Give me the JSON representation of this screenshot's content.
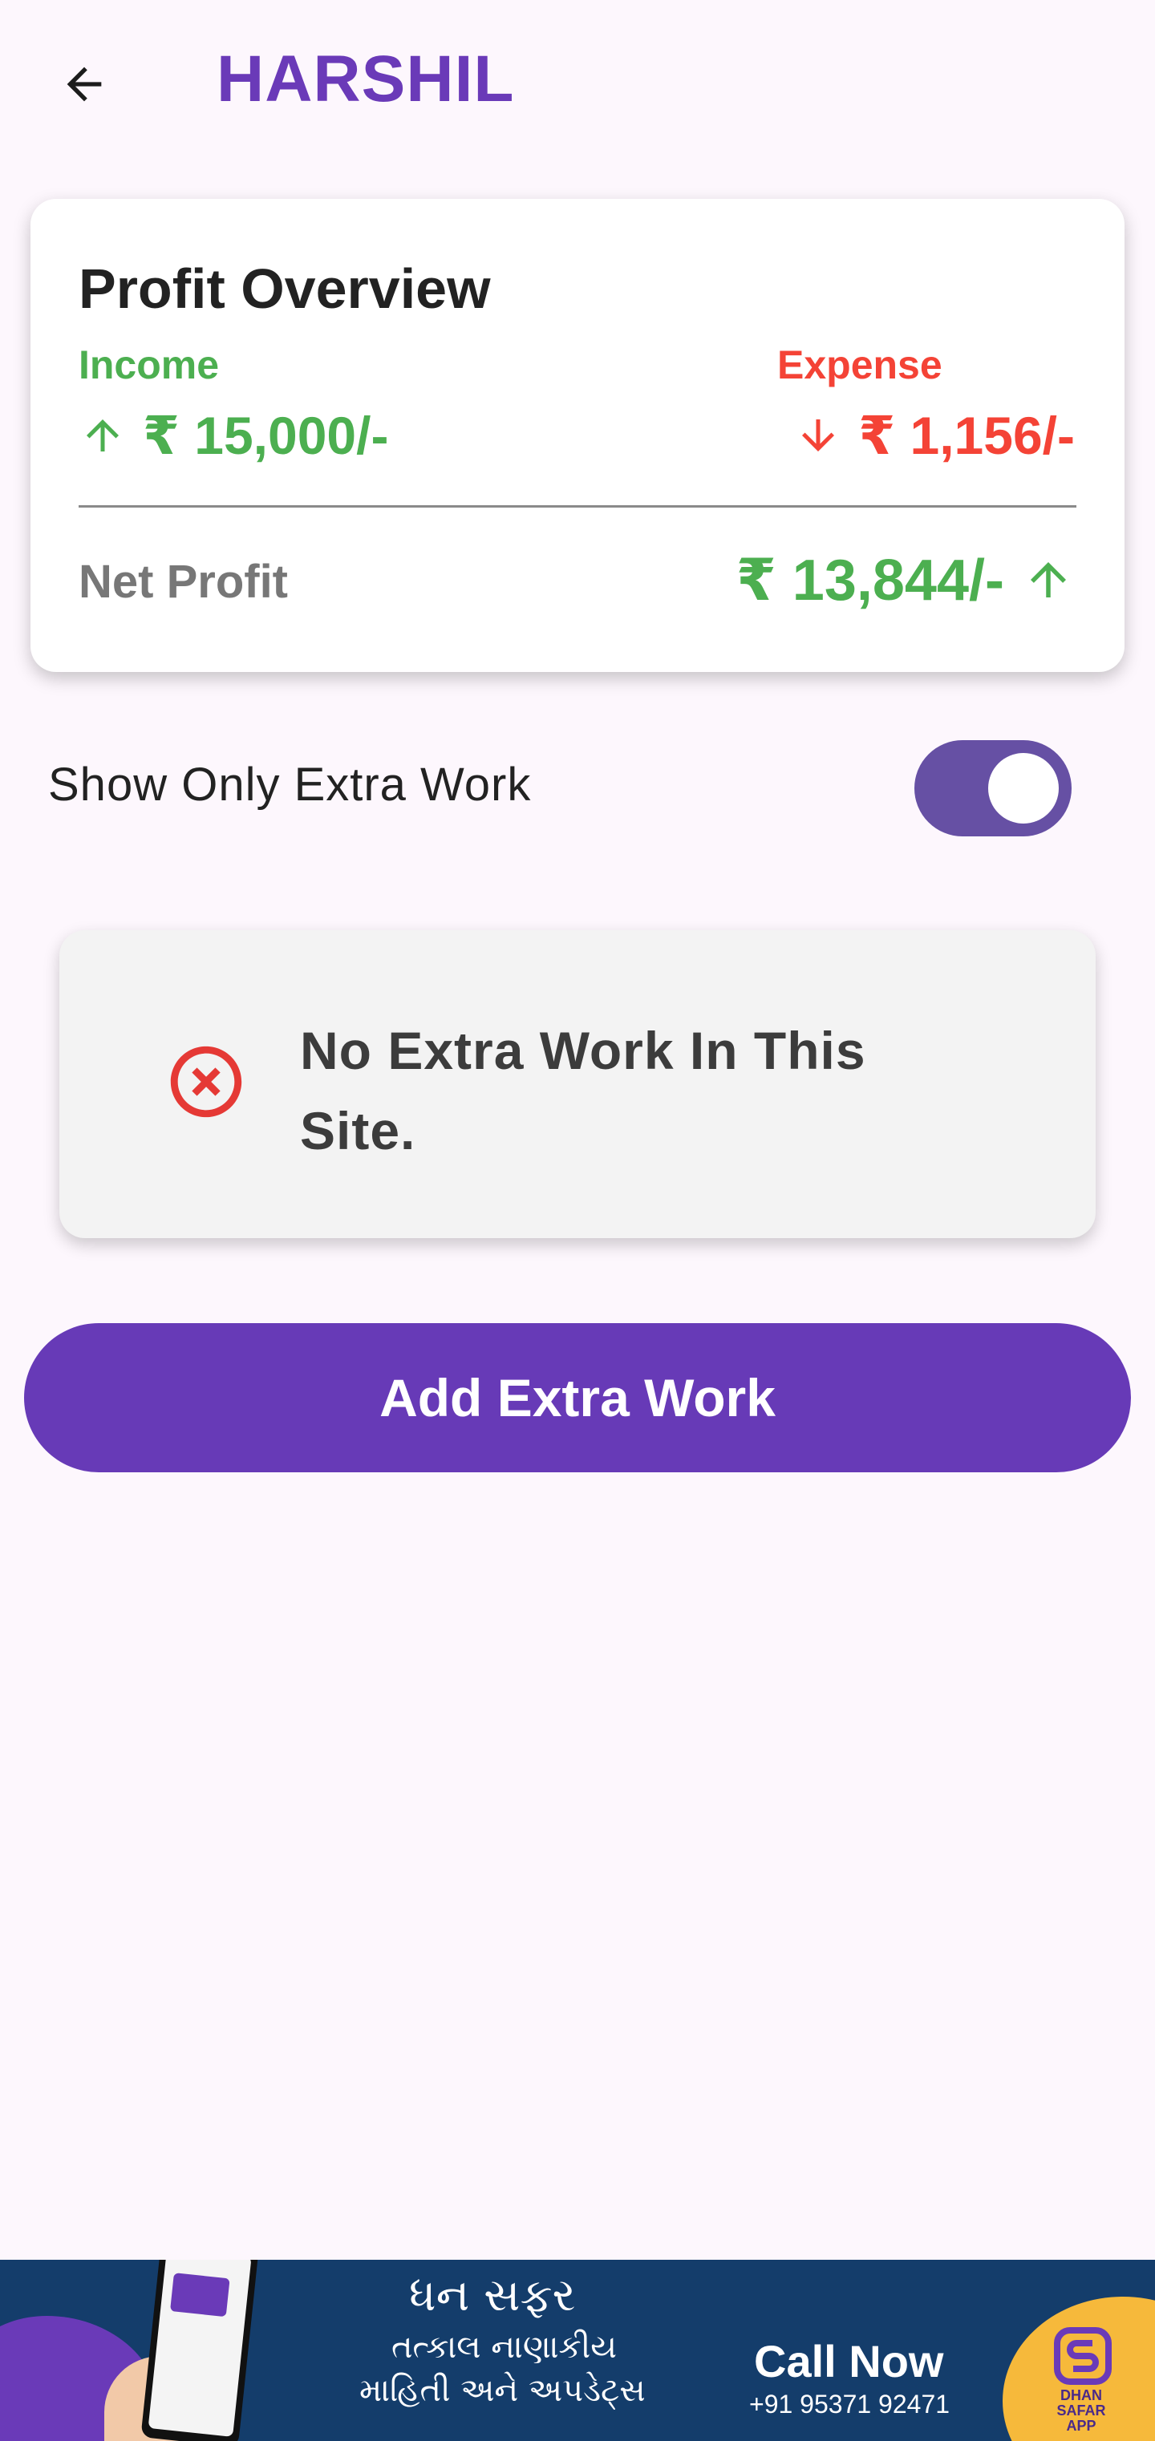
{
  "appbar": {
    "title": "HARSHIL",
    "back_icon": "arrow-back-icon"
  },
  "profit_overview": {
    "title": "Profit Overview",
    "income_label": "Income",
    "income_value": "₹ 15,000/-",
    "expense_label": "Expense",
    "expense_value": "₹ 1,156/-",
    "net_label": "Net Profit",
    "net_value": "₹ 13,844/-",
    "colors": {
      "income": "#4caf50",
      "expense": "#f44336",
      "net_label": "#777777"
    }
  },
  "filter": {
    "label": "Show Only Extra Work",
    "enabled": true,
    "toggle_color": "#6650a4"
  },
  "empty_state": {
    "icon": "error-circle-icon",
    "message_line1": "No Extra Work In This",
    "message_line2": "Site."
  },
  "actions": {
    "add_button_label": "Add Extra Work",
    "accent": "#673ab7"
  },
  "ad_banner": {
    "line1": "ધન સફર",
    "line2": "તત્કાલ નાણાકીય",
    "line3": "માહિતી અને અપડેટ્સ",
    "cta": "Call Now",
    "phone": "+91 95371 92471",
    "logo_text": "DHAN SAFAR APP"
  }
}
